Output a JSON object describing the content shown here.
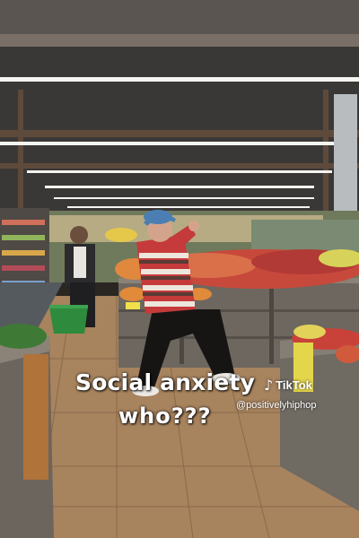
{
  "caption": {
    "line1": "Social anxiety",
    "line2": "who???"
  },
  "watermark": {
    "icon": "tiktok-note-icon",
    "brand": "TikTok",
    "handle": "@positivelyhiphop"
  },
  "colors": {
    "caption_text": "#ffffff",
    "ceiling": "#3b3a3a",
    "floor": "#a98460",
    "crate_wood": "#6f6a62",
    "hoodie_stripes": [
      "#c53a3a",
      "#ece6dc",
      "#5a3b36"
    ],
    "cap": "#4b7fb4",
    "basket": "#2e8a3c"
  }
}
